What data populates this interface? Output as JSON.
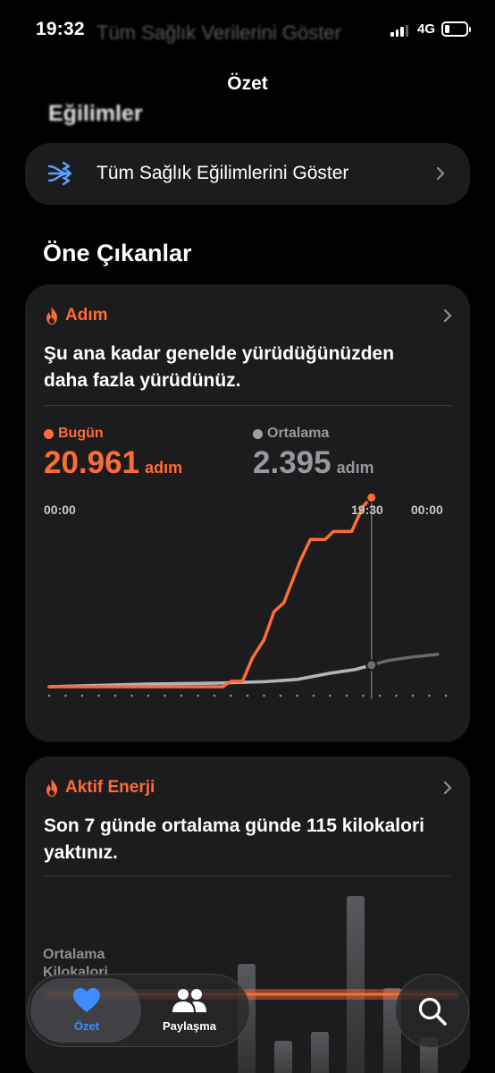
{
  "status_bar": {
    "time": "19:32",
    "network": "4G",
    "ghost_link": "Tüm Sağlık Verilerini Göster"
  },
  "nav": {
    "title": "Özet"
  },
  "trends": {
    "heading": "Eğilimler",
    "row_label": "Tüm Sağlık Eğilimlerini Göster"
  },
  "highlights": {
    "title": "Öne Çıkanlar",
    "steps": {
      "category": "Adım",
      "headline": "Şu ana kadar genelde yürüdüğünüzden daha fazla yürüdünüz.",
      "today_label": "Bugün",
      "today_value": "20.961",
      "today_unit": "adım",
      "avg_label": "Ortalama",
      "avg_value": "2.395",
      "avg_unit": "adım",
      "x_labels": [
        "00:00",
        "19:30",
        "00:00"
      ]
    },
    "energy": {
      "category": "Aktif Enerji",
      "headline": "Son 7 günde ortalama günde 115 kilokalori yaktınız.",
      "avg_caption_line1": "Ortalama",
      "avg_caption_line2": "Kilokalori"
    }
  },
  "chart_data": {
    "type": "line",
    "x_unit": "hour of day",
    "xlim": [
      0,
      24
    ],
    "ylim": [
      0,
      21000
    ],
    "x_tick_labels": [
      "00:00",
      "19:30",
      "00:00"
    ],
    "series": [
      {
        "name": "Bugün",
        "color": "#ff6b35",
        "points": [
          [
            0,
            0
          ],
          [
            9,
            0
          ],
          [
            10.5,
            0
          ],
          [
            11,
            600
          ],
          [
            11.7,
            600
          ],
          [
            12.3,
            3200
          ],
          [
            13,
            5200
          ],
          [
            13.6,
            8300
          ],
          [
            14.2,
            9300
          ],
          [
            15.2,
            14000
          ],
          [
            15.8,
            16300
          ],
          [
            16.7,
            16300
          ],
          [
            17.2,
            17200
          ],
          [
            18.3,
            17200
          ],
          [
            19,
            20000
          ],
          [
            19.5,
            20961
          ]
        ]
      },
      {
        "name": "Ortalama",
        "color": "#98989d",
        "points": [
          [
            0,
            0
          ],
          [
            6,
            300
          ],
          [
            10,
            400
          ],
          [
            13,
            550
          ],
          [
            15,
            800
          ],
          [
            17,
            1500
          ],
          [
            18.5,
            1900
          ],
          [
            19.5,
            2395
          ],
          [
            20.5,
            2900
          ],
          [
            22,
            3300
          ],
          [
            23.5,
            3600
          ]
        ]
      }
    ]
  },
  "tab_bar": {
    "summary": "Özet",
    "sharing": "Paylaşma"
  },
  "colors": {
    "accent": "#ff6b35",
    "tab_active": "#3f8cff",
    "card": "#1c1c1e",
    "average": "#98989d"
  },
  "icons": {
    "trends": "trend-arrows-icon",
    "steps": "flame-icon",
    "energy": "flame-icon",
    "summary": "heart-icon",
    "sharing": "people-icon",
    "search": "search-icon"
  }
}
